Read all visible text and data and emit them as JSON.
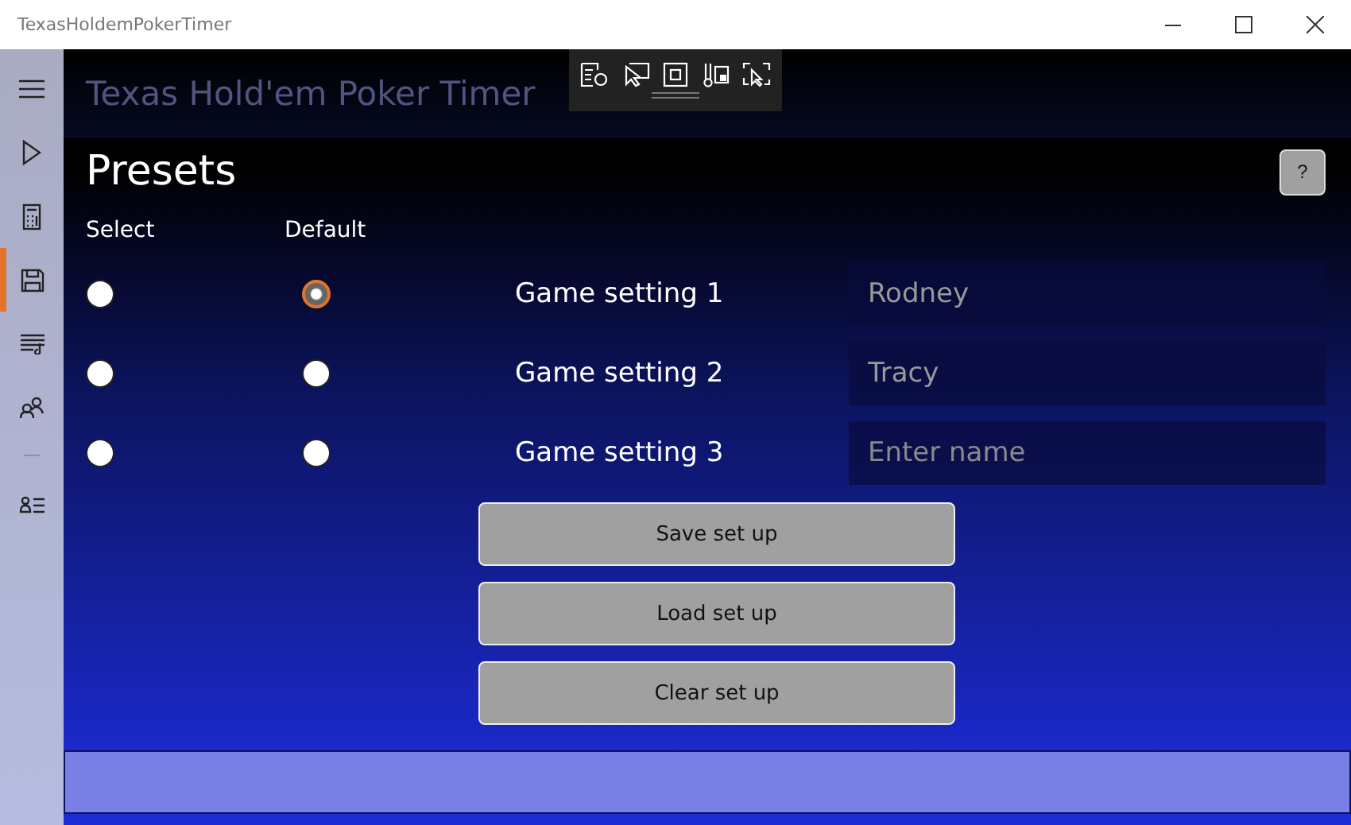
{
  "window": {
    "title": "TexasHoldemPokerTimer"
  },
  "sidebar": {
    "items": [
      {
        "kind": "menu",
        "selected": false
      },
      {
        "kind": "play",
        "selected": false
      },
      {
        "kind": "calculator",
        "selected": false
      },
      {
        "kind": "save",
        "selected": true
      },
      {
        "kind": "playlist",
        "selected": false
      },
      {
        "kind": "people",
        "selected": false
      },
      {
        "kind": "divider",
        "selected": false
      },
      {
        "kind": "contacts",
        "selected": false
      }
    ]
  },
  "header": {
    "title": "Texas Hold'em Poker Timer"
  },
  "page": {
    "title": "Presets",
    "help_button": "?",
    "select_label": "Select",
    "default_label": "Default"
  },
  "presets": [
    {
      "select": false,
      "default": true,
      "label": "Game setting 1",
      "name": "Rodney"
    },
    {
      "select": false,
      "default": false,
      "label": "Game setting 2",
      "name": "Tracy"
    },
    {
      "select": false,
      "default": false,
      "label": "Game setting 3",
      "placeholder": "Enter name"
    }
  ],
  "buttons": [
    "Save set up",
    "Load set up",
    "Clear set up"
  ]
}
